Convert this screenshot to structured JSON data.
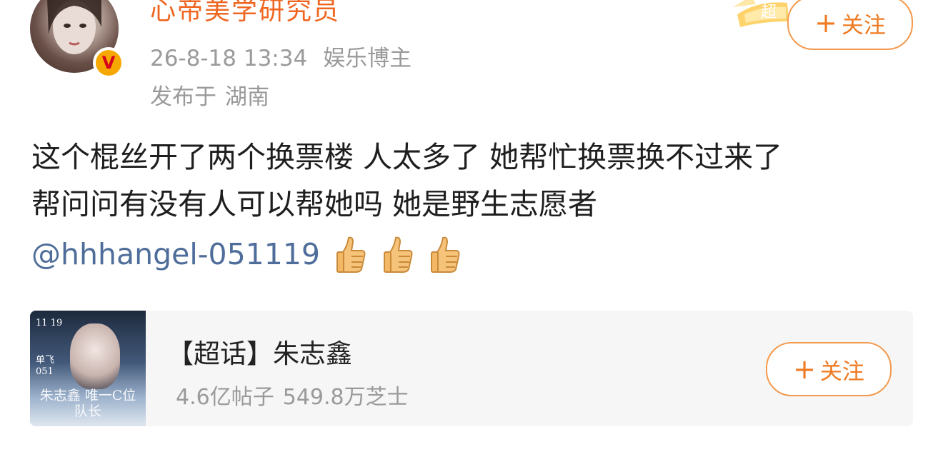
{
  "post": {
    "username": "心帝美学研究员",
    "timestamp": "26-8-18 13:34",
    "user_tag": "娱乐博主",
    "location_prefix": "发布于",
    "location": "湖南",
    "follow_label": "关注",
    "super_badge_text": "超",
    "verified_badge": "V",
    "text_line1": "这个棍丝开了两个换票楼 人太多了 她帮忙换票换不过来了",
    "text_line2": "帮问问有没有人可以帮她吗 她是野生志愿者",
    "mention": "@hhhangel-051119",
    "emojis": [
      "thumbs-up",
      "thumbs-up",
      "thumbs-up"
    ]
  },
  "card": {
    "title": "【超话】朱志鑫",
    "posts_count": "4.6亿帖子",
    "fans_count": "549.8万芝士",
    "follow_label": "关注",
    "cover": {
      "date_text": "11 19",
      "side_text": "单飞 051",
      "title_text": "朱志鑫 唯一C位队长"
    }
  },
  "colors": {
    "accent_orange": "#ef6620",
    "follow_border": "#f39a4f",
    "mention_blue": "#4f6d9a",
    "meta_gray": "#9a9a9a",
    "card_bg": "#f6f6f6"
  }
}
